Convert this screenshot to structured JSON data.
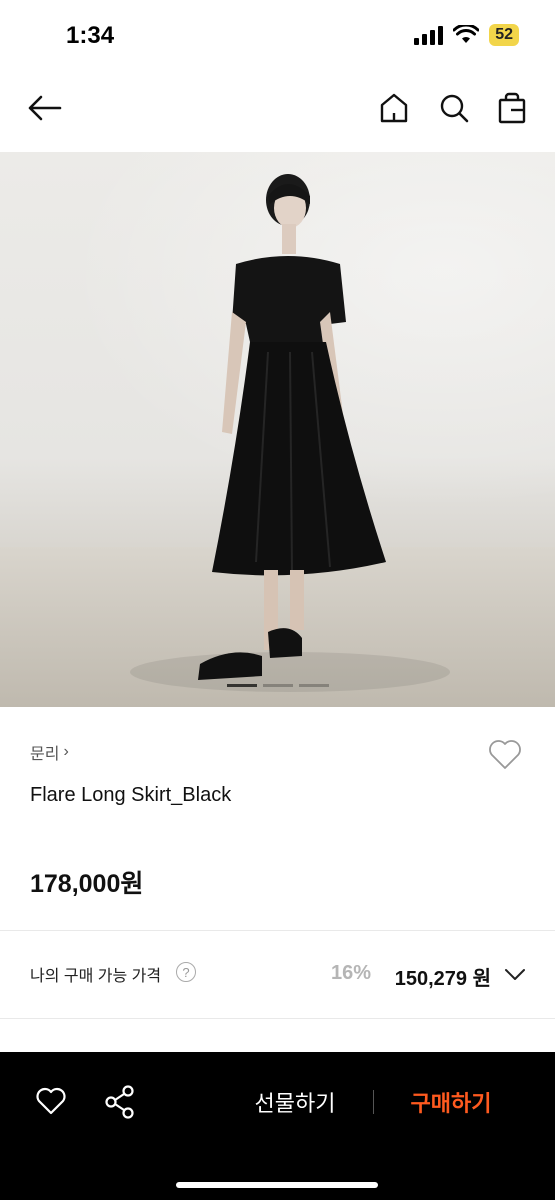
{
  "status_bar": {
    "time": "1:34",
    "battery": "52",
    "battery_color": "#f2d54a"
  },
  "nav": {
    "back_icon": "arrow-left-icon",
    "home_icon": "home-icon",
    "search_icon": "search-icon",
    "bag_icon": "shopping-bag-icon"
  },
  "product": {
    "brand": "문리",
    "brand_chevron": "›",
    "title": "Flare Long Skirt_Black",
    "price": "178,000원",
    "wishlist_icon": "heart-outline-icon"
  },
  "my_price": {
    "label": "나의 구매 가능 가격",
    "help": "?",
    "discount": "16%",
    "price": "150,279 원"
  },
  "bottom_bar": {
    "like_icon": "heart-outline-icon",
    "share_icon": "share-icon",
    "gift_label": "선물하기",
    "buy_label": "구매하기",
    "buy_color": "#ff5a1f"
  }
}
